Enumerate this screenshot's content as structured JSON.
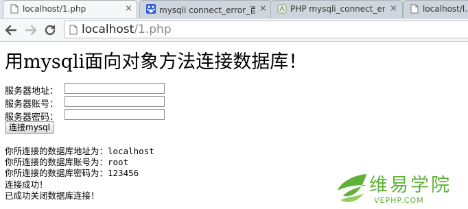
{
  "browser": {
    "tabs": [
      {
        "title": "localhost/1.php",
        "icon": "page-icon",
        "active": true
      },
      {
        "title": "mysqli connect_error_百",
        "icon": "baidu-paw-icon",
        "active": false
      },
      {
        "title": "PHP mysqli_connect_er",
        "icon": "site-icon",
        "active": false
      },
      {
        "title": "localhost/l.p",
        "icon": "page-icon",
        "active": false
      }
    ],
    "close_glyph": "×",
    "address": {
      "host": "localhost",
      "path": "/1.php"
    }
  },
  "page": {
    "heading": "用mysqli面向对象方法连接数据库！",
    "form": {
      "host_label": "服务器地址：",
      "user_label": "服务器账号：",
      "password_label": "服务器密码：",
      "host_value": "",
      "user_value": "",
      "password_value": "",
      "submit_label": "连接mysql"
    },
    "output": [
      "你所连接的数据库地址为：localhost",
      "你所连接的数据库账号为：root",
      "你所连接的数据库密码为：123456",
      "连接成功！",
      "已成功关闭数据库连接！"
    ]
  },
  "watermark": {
    "text": "维易学院",
    "subtext": "VEPHP.COM",
    "color": "#5fb237"
  }
}
